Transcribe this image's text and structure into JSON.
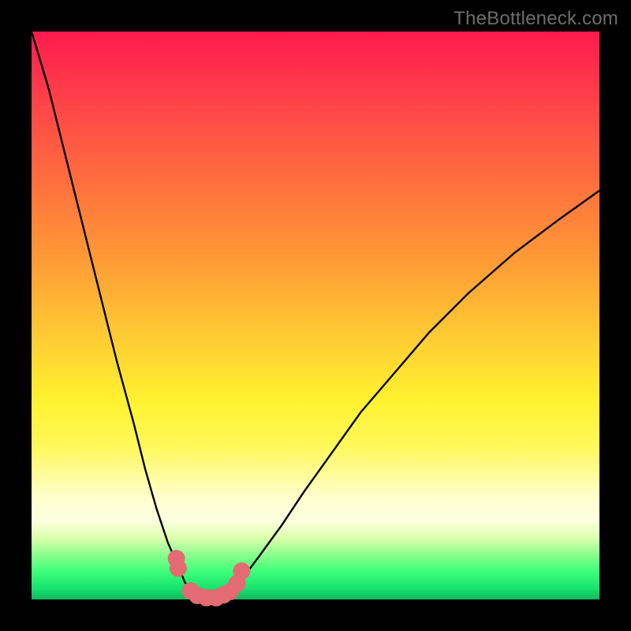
{
  "watermark": "TheBottleneck.com",
  "chart_data": {
    "type": "line",
    "title": "",
    "xlabel": "",
    "ylabel": "",
    "xlim": [
      0,
      100
    ],
    "ylim": [
      0,
      100
    ],
    "background_gradient": {
      "top": "#ff1a4d",
      "middle": "#fff22f",
      "bottom": "#0fb85e"
    },
    "series": [
      {
        "name": "bottleneck-curve",
        "color": "#000000",
        "x": [
          0,
          3,
          6,
          9,
          12,
          15,
          18,
          20,
          22,
          24,
          26,
          27,
          28.5,
          30.5,
          32.5,
          34.5,
          37,
          40,
          44,
          48,
          53,
          58,
          64,
          70,
          77,
          85,
          93,
          100
        ],
        "values": [
          100,
          90,
          78,
          66,
          54,
          42,
          31,
          23,
          16,
          10,
          5.5,
          3.0,
          1.3,
          0.3,
          0.3,
          1.2,
          3.5,
          7.5,
          13,
          19,
          26,
          33,
          40,
          47,
          54,
          61,
          67,
          72
        ]
      },
      {
        "name": "datapoint-markers",
        "color": "#e36b71",
        "marker_radius_px": 11,
        "x": [
          25.5,
          25.8,
          28.0,
          29.2,
          30.8,
          32.5,
          33.8,
          35.0,
          36.2,
          37.0
        ],
        "values": [
          7.2,
          5.5,
          1.5,
          0.7,
          0.3,
          0.3,
          0.8,
          1.4,
          2.8,
          5.0
        ]
      }
    ]
  }
}
